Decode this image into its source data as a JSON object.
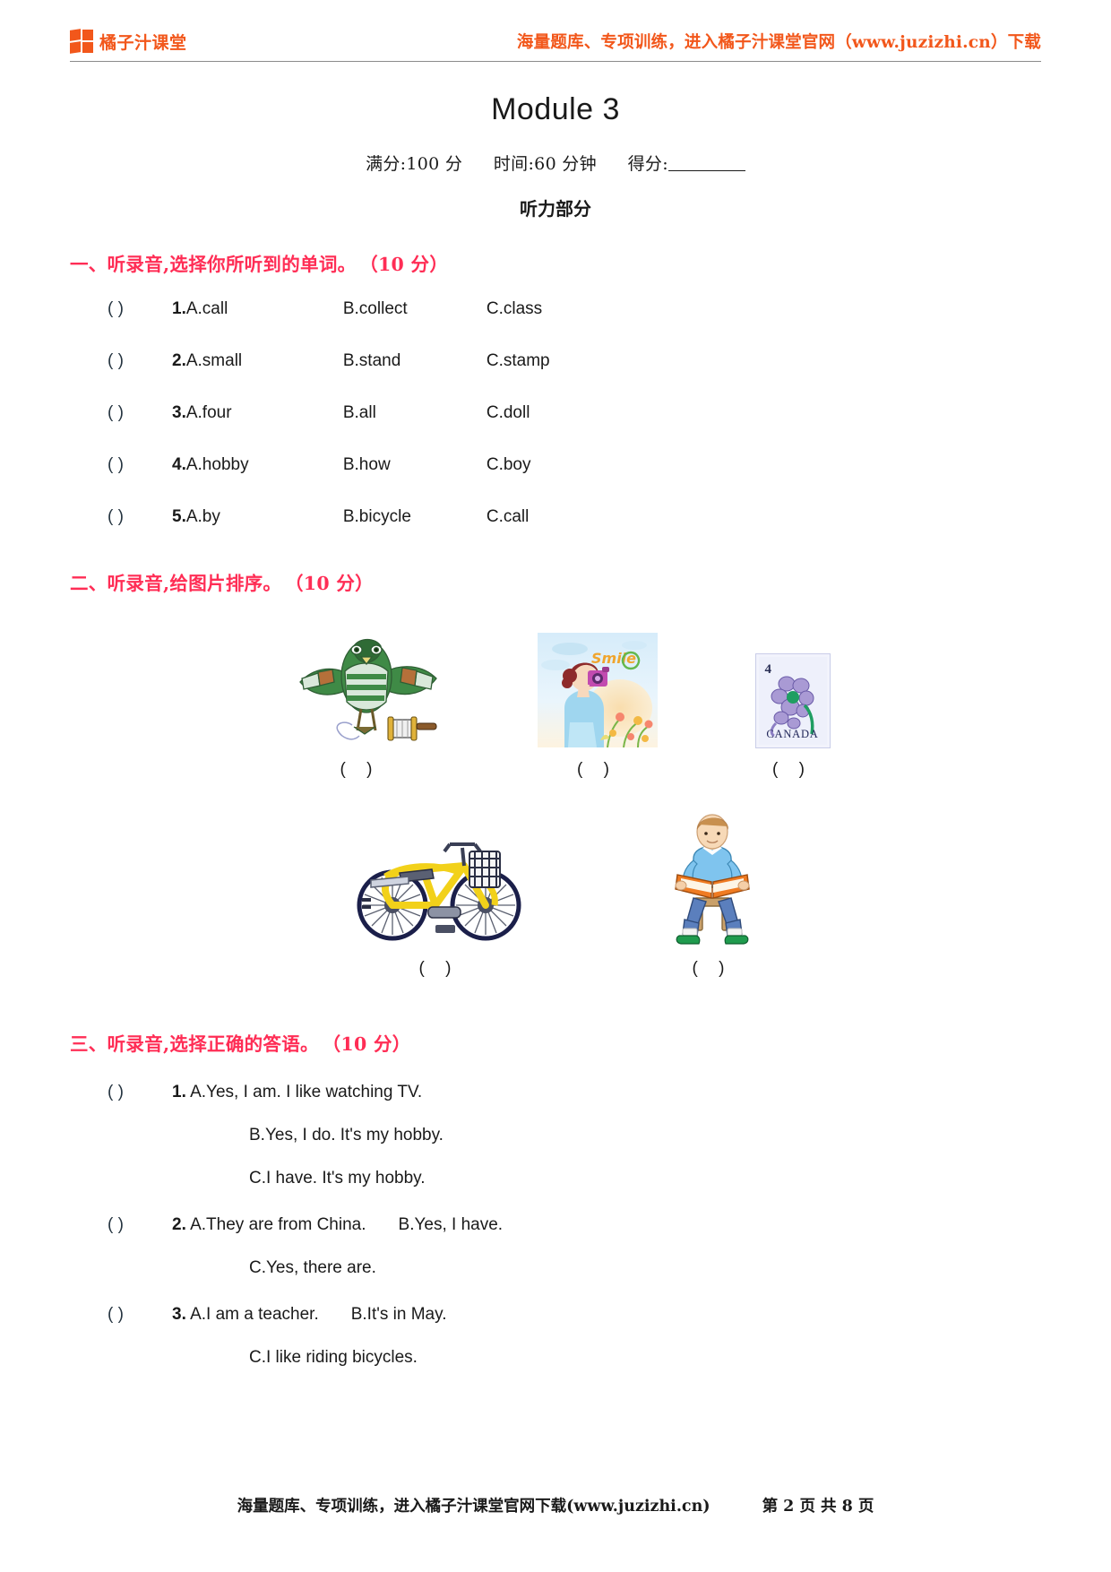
{
  "header": {
    "brand_name": "橘子汁课堂",
    "brand_color": "#f2571b",
    "promo_text": "海量题库、专项训练，进入橘子汁课堂官网（www.juzizhi.cn）下载"
  },
  "title": "Module 3",
  "score_line": {
    "full_marks": "满分:100 分",
    "time": "时间:60 分钟",
    "score": "得分:"
  },
  "part_title": "听力部分",
  "section_color": "#ff2d55",
  "sections": [
    {
      "heading": "一、听录音,选择你所听到的单词。",
      "score": "（10 分）",
      "questions": [
        {
          "paren": "(      )",
          "num": "1.",
          "a": "A.call",
          "b": "B.collect",
          "c": "C.class"
        },
        {
          "paren": "(      )",
          "num": "2.",
          "a": "A.small",
          "b": "B.stand",
          "c": "C.stamp"
        },
        {
          "paren": "(      )",
          "num": "3.",
          "a": "A.four",
          "b": "B.all",
          "c": "C.doll"
        },
        {
          "paren": "(      )",
          "num": "4.",
          "a": "A.hobby",
          "b": "B.how",
          "c": "C.boy"
        },
        {
          "paren": "(      )",
          "num": "5.",
          "a": "A.by",
          "b": "B.bicycle",
          "c": "C.call"
        }
      ]
    },
    {
      "heading": "二、听录音,给图片排序。",
      "score": "（10 分）",
      "pictures": [
        {
          "icon": "kite-illustration",
          "answer_box": "(    )"
        },
        {
          "icon": "girl-taking-photo-illustration",
          "answer_box": "(    )"
        },
        {
          "icon": "canada-stamp-illustration",
          "answer_box": "(    )"
        },
        {
          "icon": "yellow-bicycle-illustration",
          "answer_box": "(    )"
        },
        {
          "icon": "boy-reading-book-illustration",
          "answer_box": "(    )"
        }
      ],
      "stamp": {
        "denomination": "4",
        "country": "CANADA"
      },
      "photo_card_text": "Smile"
    },
    {
      "heading": "三、听录音,选择正确的答语。",
      "score": "（10 分）",
      "questions": [
        {
          "paren": "(      )",
          "num": "1.",
          "lines": [
            "A.Yes, I am. I like watching TV.",
            "B.Yes, I do. It's my hobby.",
            "C.I have. It's my hobby."
          ]
        },
        {
          "paren": "(      )",
          "num": "2.",
          "lines": [
            "A.They are from China.",
            "B.Yes, I have.",
            "C.Yes, there are."
          ]
        },
        {
          "paren": "(      )",
          "num": "3.",
          "lines": [
            "A.I am a teacher.",
            "B.It's in May.",
            "C.I like riding bicycles."
          ]
        }
      ]
    }
  ],
  "footer": {
    "promo": "海量题库、专项训练，进入橘子汁课堂官网下载(www.juzizhi.cn)",
    "page_info": "第 2 页 共 8 页"
  }
}
